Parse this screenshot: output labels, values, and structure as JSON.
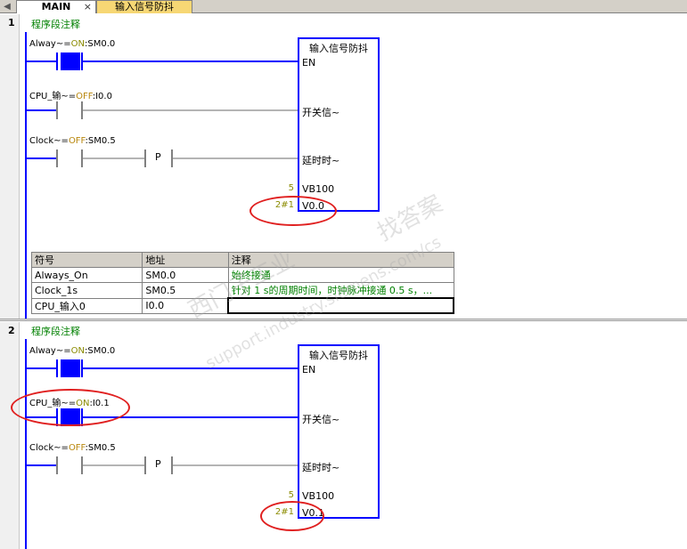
{
  "tabs": {
    "main_label": "MAIN",
    "close_glyph": "×",
    "sub_label": "输入信号防抖"
  },
  "networks": [
    {
      "number": "1",
      "comment": "程序段注释",
      "contact1": {
        "name": "Alway~",
        "eq": "=",
        "state": "ON",
        "addr": ":SM0.0"
      },
      "contact2": {
        "name": "CPU_输~",
        "eq": "=",
        "state": "OFF",
        "addr": ":I0.0"
      },
      "contact3": {
        "name": "Clock~",
        "eq": "=",
        "state": "OFF",
        "addr": ":SM0.5"
      },
      "p_label": "P",
      "block": {
        "title": "输入信号防抖",
        "pin_en": "EN",
        "pin_in1": "开关信~",
        "pin_in2": "延时时~",
        "pin_in3_val": "5",
        "pin_in3": "VB100",
        "pin_out_val": "2#1",
        "pin_out": "V0.0"
      }
    },
    {
      "number": "2",
      "comment": "程序段注释",
      "contact1": {
        "name": "Alway~",
        "eq": "=",
        "state": "ON",
        "addr": ":SM0.0"
      },
      "contact2": {
        "name": "CPU_输~",
        "eq": "=",
        "state": "ON",
        "addr": ":I0.1"
      },
      "contact3": {
        "name": "Clock~",
        "eq": "=",
        "state": "OFF",
        "addr": ":SM0.5"
      },
      "p_label": "P",
      "block": {
        "title": "输入信号防抖",
        "pin_en": "EN",
        "pin_in1": "开关信~",
        "pin_in2": "延时时~",
        "pin_in3_val": "5",
        "pin_in3": "VB100",
        "pin_out_val": "2#1",
        "pin_out": "V0.1"
      }
    }
  ],
  "symbol_table": {
    "headers": [
      "符号",
      "地址",
      "注释"
    ],
    "rows": [
      [
        "Always_On",
        "SM0.0",
        "始终接通"
      ],
      [
        "Clock_1s",
        "SM0.5",
        "针对 1 s的周期时间，时钟脉冲接通 0.5 s，..."
      ],
      [
        "CPU_输入0",
        "I0.0",
        ""
      ]
    ]
  },
  "watermark": {
    "line1": "西门子工业",
    "line2": "support.industry.siemens.com/cs",
    "line3": "找答案"
  },
  "colors": {
    "power_on": "#0000ff",
    "power_off": "#b4b4b4",
    "comment_green": "#008000",
    "highlight_red": "#e02020",
    "tab_active_yellow": "#f7d774"
  }
}
